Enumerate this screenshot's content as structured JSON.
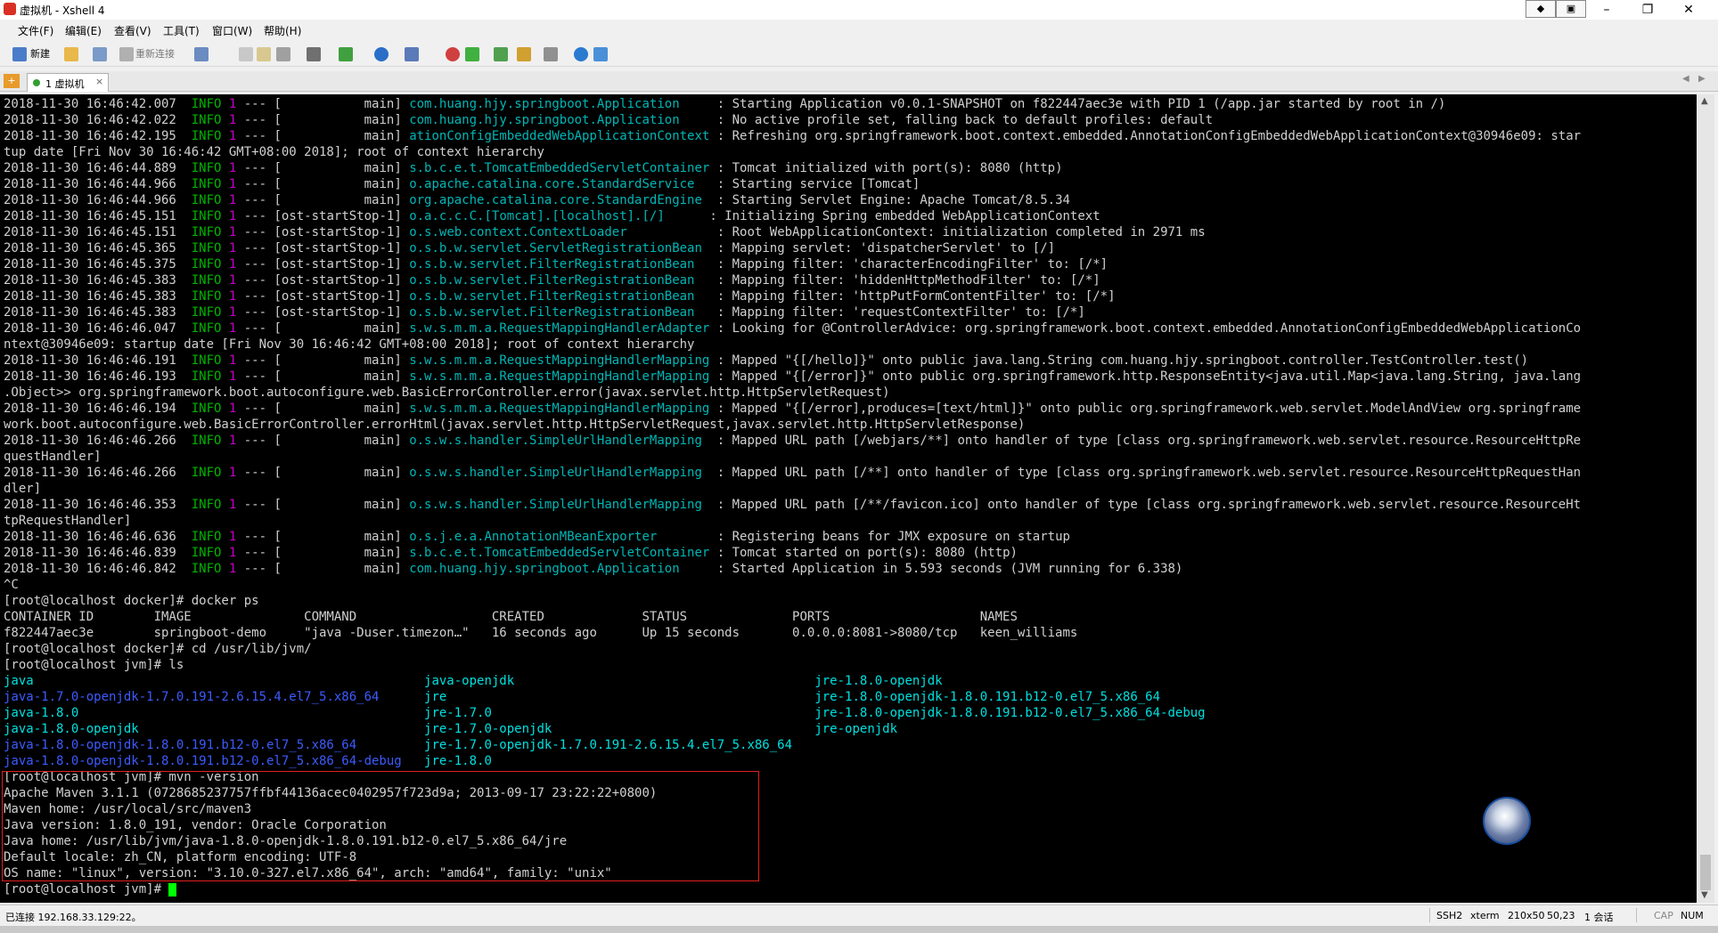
{
  "window": {
    "title": "虚拟机 - Xshell 4",
    "controls": {
      "restore_small": "◆",
      "pin": "▣",
      "minimize": "–",
      "maximize": "❐",
      "close": "✕"
    }
  },
  "menu": {
    "items": [
      "文件(F)",
      "编辑(E)",
      "查看(V)",
      "工具(T)",
      "窗口(W)",
      "帮助(H)"
    ]
  },
  "toolbar": {
    "new_label": "新建",
    "reconnect_label": "重新连接"
  },
  "tabs": {
    "items": [
      {
        "label": "1 虚拟机",
        "close": "×"
      }
    ]
  },
  "terminal": {
    "lines": [
      [
        {
          "t": "2018-11-30 16:46:42.007  "
        },
        {
          "t": "INFO",
          "c": "info"
        },
        {
          "t": " "
        },
        {
          "t": "1",
          "c": "pid"
        },
        {
          "t": " --- [           main] "
        },
        {
          "t": "com.huang.hjy.springboot.Application    ",
          "c": "logger"
        },
        {
          "t": " : Starting Application v0.0.1-SNAPSHOT on f822447aec3e with PID 1 (/app.jar started by root in /)"
        }
      ],
      [
        {
          "t": "2018-11-30 16:46:42.022  "
        },
        {
          "t": "INFO",
          "c": "info"
        },
        {
          "t": " "
        },
        {
          "t": "1",
          "c": "pid"
        },
        {
          "t": " --- [           main] "
        },
        {
          "t": "com.huang.hjy.springboot.Application    ",
          "c": "logger"
        },
        {
          "t": " : No active profile set, falling back to default profiles: default"
        }
      ],
      [
        {
          "t": "2018-11-30 16:46:42.195  "
        },
        {
          "t": "INFO",
          "c": "info"
        },
        {
          "t": " "
        },
        {
          "t": "1",
          "c": "pid"
        },
        {
          "t": " --- [           main] "
        },
        {
          "t": "ationConfigEmbeddedWebApplicationContext",
          "c": "logger"
        },
        {
          "t": " : Refreshing org.springframework.boot.context.embedded.AnnotationConfigEmbeddedWebApplicationContext@30946e09: star"
        }
      ],
      [
        {
          "t": "tup date [Fri Nov 30 16:46:42 GMT+08:00 2018]; root of context hierarchy"
        }
      ],
      [
        {
          "t": "2018-11-30 16:46:44.889  "
        },
        {
          "t": "INFO",
          "c": "info"
        },
        {
          "t": " "
        },
        {
          "t": "1",
          "c": "pid"
        },
        {
          "t": " --- [           main] "
        },
        {
          "t": "s.b.c.e.t.TomcatEmbeddedServletContainer",
          "c": "logger"
        },
        {
          "t": " : Tomcat initialized with port(s): 8080 (http)"
        }
      ],
      [
        {
          "t": "2018-11-30 16:46:44.966  "
        },
        {
          "t": "INFO",
          "c": "info"
        },
        {
          "t": " "
        },
        {
          "t": "1",
          "c": "pid"
        },
        {
          "t": " --- [           main] "
        },
        {
          "t": "o.apache.catalina.core.StandardService  ",
          "c": "logger"
        },
        {
          "t": " : Starting service [Tomcat]"
        }
      ],
      [
        {
          "t": "2018-11-30 16:46:44.966  "
        },
        {
          "t": "INFO",
          "c": "info"
        },
        {
          "t": " "
        },
        {
          "t": "1",
          "c": "pid"
        },
        {
          "t": " --- [           main] "
        },
        {
          "t": "org.apache.catalina.core.StandardEngine ",
          "c": "logger"
        },
        {
          "t": " : Starting Servlet Engine: Apache Tomcat/8.5.34"
        }
      ],
      [
        {
          "t": "2018-11-30 16:46:45.151  "
        },
        {
          "t": "INFO",
          "c": "info"
        },
        {
          "t": " "
        },
        {
          "t": "1",
          "c": "pid"
        },
        {
          "t": " --- [ost-startStop-1] "
        },
        {
          "t": "o.a.c.c.C.[Tomcat].[localhost].[/]     ",
          "c": "logger"
        },
        {
          "t": " : Initializing Spring embedded WebApplicationContext"
        }
      ],
      [
        {
          "t": "2018-11-30 16:46:45.151  "
        },
        {
          "t": "INFO",
          "c": "info"
        },
        {
          "t": " "
        },
        {
          "t": "1",
          "c": "pid"
        },
        {
          "t": " --- [ost-startStop-1] "
        },
        {
          "t": "o.s.web.context.ContextLoader           ",
          "c": "logger"
        },
        {
          "t": " : Root WebApplicationContext: initialization completed in 2971 ms"
        }
      ],
      [
        {
          "t": "2018-11-30 16:46:45.365  "
        },
        {
          "t": "INFO",
          "c": "info"
        },
        {
          "t": " "
        },
        {
          "t": "1",
          "c": "pid"
        },
        {
          "t": " --- [ost-startStop-1] "
        },
        {
          "t": "o.s.b.w.servlet.ServletRegistrationBean ",
          "c": "logger"
        },
        {
          "t": " : Mapping servlet: 'dispatcherServlet' to [/]"
        }
      ],
      [
        {
          "t": "2018-11-30 16:46:45.375  "
        },
        {
          "t": "INFO",
          "c": "info"
        },
        {
          "t": " "
        },
        {
          "t": "1",
          "c": "pid"
        },
        {
          "t": " --- [ost-startStop-1] "
        },
        {
          "t": "o.s.b.w.servlet.FilterRegistrationBean  ",
          "c": "logger"
        },
        {
          "t": " : Mapping filter: 'characterEncodingFilter' to: [/*]"
        }
      ],
      [
        {
          "t": "2018-11-30 16:46:45.383  "
        },
        {
          "t": "INFO",
          "c": "info"
        },
        {
          "t": " "
        },
        {
          "t": "1",
          "c": "pid"
        },
        {
          "t": " --- [ost-startStop-1] "
        },
        {
          "t": "o.s.b.w.servlet.FilterRegistrationBean  ",
          "c": "logger"
        },
        {
          "t": " : Mapping filter: 'hiddenHttpMethodFilter' to: [/*]"
        }
      ],
      [
        {
          "t": "2018-11-30 16:46:45.383  "
        },
        {
          "t": "INFO",
          "c": "info"
        },
        {
          "t": " "
        },
        {
          "t": "1",
          "c": "pid"
        },
        {
          "t": " --- [ost-startStop-1] "
        },
        {
          "t": "o.s.b.w.servlet.FilterRegistrationBean  ",
          "c": "logger"
        },
        {
          "t": " : Mapping filter: 'httpPutFormContentFilter' to: [/*]"
        }
      ],
      [
        {
          "t": "2018-11-30 16:46:45.383  "
        },
        {
          "t": "INFO",
          "c": "info"
        },
        {
          "t": " "
        },
        {
          "t": "1",
          "c": "pid"
        },
        {
          "t": " --- [ost-startStop-1] "
        },
        {
          "t": "o.s.b.w.servlet.FilterRegistrationBean  ",
          "c": "logger"
        },
        {
          "t": " : Mapping filter: 'requestContextFilter' to: [/*]"
        }
      ],
      [
        {
          "t": "2018-11-30 16:46:46.047  "
        },
        {
          "t": "INFO",
          "c": "info"
        },
        {
          "t": " "
        },
        {
          "t": "1",
          "c": "pid"
        },
        {
          "t": " --- [           main] "
        },
        {
          "t": "s.w.s.m.m.a.RequestMappingHandlerAdapter",
          "c": "logger"
        },
        {
          "t": " : Looking for @ControllerAdvice: org.springframework.boot.context.embedded.AnnotationConfigEmbeddedWebApplicationCo"
        }
      ],
      [
        {
          "t": "ntext@30946e09: startup date [Fri Nov 30 16:46:42 GMT+08:00 2018]; root of context hierarchy"
        }
      ],
      [
        {
          "t": "2018-11-30 16:46:46.191  "
        },
        {
          "t": "INFO",
          "c": "info"
        },
        {
          "t": " "
        },
        {
          "t": "1",
          "c": "pid"
        },
        {
          "t": " --- [           main] "
        },
        {
          "t": "s.w.s.m.m.a.RequestMappingHandlerMapping",
          "c": "logger"
        },
        {
          "t": " : Mapped \"{[/hello]}\" onto public java.lang.String com.huang.hjy.springboot.controller.TestController.test()"
        }
      ],
      [
        {
          "t": "2018-11-30 16:46:46.193  "
        },
        {
          "t": "INFO",
          "c": "info"
        },
        {
          "t": " "
        },
        {
          "t": "1",
          "c": "pid"
        },
        {
          "t": " --- [           main] "
        },
        {
          "t": "s.w.s.m.m.a.RequestMappingHandlerMapping",
          "c": "logger"
        },
        {
          "t": " : Mapped \"{[/error]}\" onto public org.springframework.http.ResponseEntity<java.util.Map<java.lang.String, java.lang"
        }
      ],
      [
        {
          "t": ".Object>> org.springframework.boot.autoconfigure.web.BasicErrorController.error(javax.servlet.http.HttpServletRequest)"
        }
      ],
      [
        {
          "t": "2018-11-30 16:46:46.194  "
        },
        {
          "t": "INFO",
          "c": "info"
        },
        {
          "t": " "
        },
        {
          "t": "1",
          "c": "pid"
        },
        {
          "t": " --- [           main] "
        },
        {
          "t": "s.w.s.m.m.a.RequestMappingHandlerMapping",
          "c": "logger"
        },
        {
          "t": " : Mapped \"{[/error],produces=[text/html]}\" onto public org.springframework.web.servlet.ModelAndView org.springframe"
        }
      ],
      [
        {
          "t": "work.boot.autoconfigure.web.BasicErrorController.errorHtml(javax.servlet.http.HttpServletRequest,javax.servlet.http.HttpServletResponse)"
        }
      ],
      [
        {
          "t": "2018-11-30 16:46:46.266  "
        },
        {
          "t": "INFO",
          "c": "info"
        },
        {
          "t": " "
        },
        {
          "t": "1",
          "c": "pid"
        },
        {
          "t": " --- [           main] "
        },
        {
          "t": "o.s.w.s.handler.SimpleUrlHandlerMapping ",
          "c": "logger"
        },
        {
          "t": " : Mapped URL path [/webjars/**] onto handler of type [class org.springframework.web.servlet.resource.ResourceHttpRe"
        }
      ],
      [
        {
          "t": "questHandler]"
        }
      ],
      [
        {
          "t": "2018-11-30 16:46:46.266  "
        },
        {
          "t": "INFO",
          "c": "info"
        },
        {
          "t": " "
        },
        {
          "t": "1",
          "c": "pid"
        },
        {
          "t": " --- [           main] "
        },
        {
          "t": "o.s.w.s.handler.SimpleUrlHandlerMapping ",
          "c": "logger"
        },
        {
          "t": " : Mapped URL path [/**] onto handler of type [class org.springframework.web.servlet.resource.ResourceHttpRequestHan"
        }
      ],
      [
        {
          "t": "dler]"
        }
      ],
      [
        {
          "t": "2018-11-30 16:46:46.353  "
        },
        {
          "t": "INFO",
          "c": "info"
        },
        {
          "t": " "
        },
        {
          "t": "1",
          "c": "pid"
        },
        {
          "t": " --- [           main] "
        },
        {
          "t": "o.s.w.s.handler.SimpleUrlHandlerMapping ",
          "c": "logger"
        },
        {
          "t": " : Mapped URL path [/**/favicon.ico] onto handler of type [class org.springframework.web.servlet.resource.ResourceHt"
        }
      ],
      [
        {
          "t": "tpRequestHandler]"
        }
      ],
      [
        {
          "t": "2018-11-30 16:46:46.636  "
        },
        {
          "t": "INFO",
          "c": "info"
        },
        {
          "t": " "
        },
        {
          "t": "1",
          "c": "pid"
        },
        {
          "t": " --- [           main] "
        },
        {
          "t": "o.s.j.e.a.AnnotationMBeanExporter       ",
          "c": "logger"
        },
        {
          "t": " : Registering beans for JMX exposure on startup"
        }
      ],
      [
        {
          "t": "2018-11-30 16:46:46.839  "
        },
        {
          "t": "INFO",
          "c": "info"
        },
        {
          "t": " "
        },
        {
          "t": "1",
          "c": "pid"
        },
        {
          "t": " --- [           main] "
        },
        {
          "t": "s.b.c.e.t.TomcatEmbeddedServletContainer",
          "c": "logger"
        },
        {
          "t": " : Tomcat started on port(s): 8080 (http)"
        }
      ],
      [
        {
          "t": "2018-11-30 16:46:46.842  "
        },
        {
          "t": "INFO",
          "c": "info"
        },
        {
          "t": " "
        },
        {
          "t": "1",
          "c": "pid"
        },
        {
          "t": " --- [           main] "
        },
        {
          "t": "com.huang.hjy.springboot.Application    ",
          "c": "logger"
        },
        {
          "t": " : Started Application in 5.593 seconds (JVM running for 6.338)"
        }
      ],
      [
        {
          "t": "^C"
        }
      ],
      [
        {
          "t": "[root@localhost docker]# docker ps"
        }
      ],
      [
        {
          "t": "CONTAINER ID        IMAGE               COMMAND                  CREATED             STATUS              PORTS                    NAMES"
        }
      ],
      [
        {
          "t": "f822447aec3e        springboot-demo     \"java -Duser.timezon…\"   16 seconds ago      Up 15 seconds       0.0.0.0:8081->8080/tcp   keen_williams"
        }
      ],
      [
        {
          "t": "[root@localhost docker]# cd /usr/lib/jvm/"
        }
      ],
      [
        {
          "t": "[root@localhost jvm]# ls"
        }
      ],
      [
        {
          "t": "java                                                    ",
          "c": "cyan"
        },
        {
          "t": "java-openjdk                                        ",
          "c": "cyan"
        },
        {
          "t": "jre-1.8.0-openjdk",
          "c": "cyan"
        }
      ],
      [
        {
          "t": "java-1.7.0-openjdk-1.7.0.191-2.6.15.4.el7_5.x86_64      ",
          "c": "blue"
        },
        {
          "t": "jre                                                 ",
          "c": "cyan"
        },
        {
          "t": "jre-1.8.0-openjdk-1.8.0.191.b12-0.el7_5.x86_64",
          "c": "cyan"
        }
      ],
      [
        {
          "t": "java-1.8.0                                              ",
          "c": "cyan"
        },
        {
          "t": "jre-1.7.0                                           ",
          "c": "cyan"
        },
        {
          "t": "jre-1.8.0-openjdk-1.8.0.191.b12-0.el7_5.x86_64-debug",
          "c": "cyan"
        }
      ],
      [
        {
          "t": "java-1.8.0-openjdk                                      ",
          "c": "cyan"
        },
        {
          "t": "jre-1.7.0-openjdk                                   ",
          "c": "cyan"
        },
        {
          "t": "jre-openjdk",
          "c": "cyan"
        }
      ],
      [
        {
          "t": "java-1.8.0-openjdk-1.8.0.191.b12-0.el7_5.x86_64         ",
          "c": "blue"
        },
        {
          "t": "jre-1.7.0-openjdk-1.7.0.191-2.6.15.4.el7_5.x86_64",
          "c": "cyan"
        }
      ],
      [
        {
          "t": "java-1.8.0-openjdk-1.8.0.191.b12-0.el7_5.x86_64-debug   ",
          "c": "blue"
        },
        {
          "t": "jre-1.8.0",
          "c": "cyan"
        }
      ],
      [
        {
          "t": "[root@localhost jvm]# mvn -version"
        }
      ],
      [
        {
          "t": "Apache Maven 3.1.1 (0728685237757ffbf44136acec0402957f723d9a; 2013-09-17 23:22:22+0800)"
        }
      ],
      [
        {
          "t": "Maven home: /usr/local/src/maven3"
        }
      ],
      [
        {
          "t": "Java version: 1.8.0_191, vendor: Oracle Corporation"
        }
      ],
      [
        {
          "t": "Java home: /usr/lib/jvm/java-1.8.0-openjdk-1.8.0.191.b12-0.el7_5.x86_64/jre"
        }
      ],
      [
        {
          "t": "Default locale: zh_CN, platform encoding: UTF-8"
        }
      ],
      [
        {
          "t": "OS name: \"linux\", version: \"3.10.0-327.el7.x86_64\", arch: \"amd64\", family: \"unix\""
        }
      ],
      [
        {
          "t": "[root@localhost jvm]# "
        },
        {
          "cursor": true
        }
      ]
    ]
  },
  "status": {
    "connection": "已连接 192.168.33.129:22。",
    "protocol": "SSH2",
    "term": "xterm",
    "size": "210x50",
    "pos": "50,23",
    "sessions": "1 会话",
    "cap": "CAP",
    "num": "NUM"
  },
  "colors": {
    "terminal_bg": "#000000",
    "info": "#00b400",
    "pid": "#c400c4",
    "logger": "#00b6b6",
    "dir_blue": "#3b5cff",
    "dir_cyan": "#00e0e0",
    "cursor": "#00ff00",
    "highlight": "#e02020"
  }
}
